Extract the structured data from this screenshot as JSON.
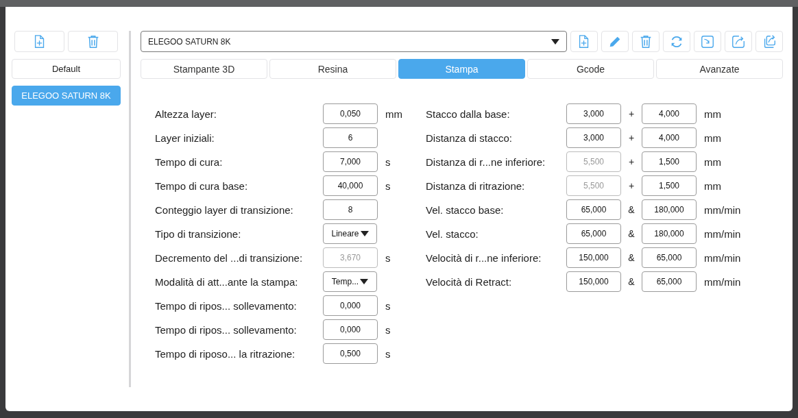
{
  "sidebar": {
    "items": [
      {
        "label": "Default",
        "selected": false
      },
      {
        "label": "ELEGOO SATURN 8K",
        "selected": true
      }
    ]
  },
  "printer_select": {
    "value": "ELEGOO SATURN 8K"
  },
  "tabs": [
    {
      "label": "Stampante 3D",
      "selected": false
    },
    {
      "label": "Resina",
      "selected": false
    },
    {
      "label": "Stampa",
      "selected": true
    },
    {
      "label": "Gcode",
      "selected": false
    },
    {
      "label": "Avanzate",
      "selected": false
    }
  ],
  "left_settings": [
    {
      "label": "Altezza layer:",
      "kind": "input",
      "value": "0,050",
      "disabled": false,
      "unit": "mm"
    },
    {
      "label": "Layer iniziali:",
      "kind": "input",
      "value": "6",
      "disabled": false
    },
    {
      "label": "Tempo di cura:",
      "kind": "input",
      "value": "7,000",
      "disabled": false,
      "unit": "s"
    },
    {
      "label": "Tempo di cura base:",
      "kind": "input",
      "value": "40,000",
      "disabled": false,
      "unit": "s"
    },
    {
      "label": "Conteggio layer di transizione:",
      "kind": "input",
      "value": "8",
      "disabled": false
    },
    {
      "label": "Tipo di transizione:",
      "kind": "dropdown",
      "value": "Lineare",
      "disabled": false
    },
    {
      "label": "Decremento del ...di transizione:",
      "kind": "input",
      "value": "3,670",
      "disabled": true,
      "unit": "s"
    },
    {
      "label": "Modalità di att...ante la stampa:",
      "kind": "dropdown",
      "value": "Temp...",
      "disabled": false
    },
    {
      "label": "Tempo di ripos... sollevamento:",
      "kind": "input",
      "value": "0,000",
      "disabled": false,
      "unit": "s"
    },
    {
      "label": "Tempo di ripos... sollevamento:",
      "kind": "input",
      "value": "0,000",
      "disabled": false,
      "unit": "s"
    },
    {
      "label": "Tempo di riposo... la ritrazione:",
      "kind": "input",
      "value": "0,500",
      "disabled": false,
      "unit": "s"
    }
  ],
  "right_settings": [
    {
      "label": "Stacco dalla base:",
      "value_1": "3,000",
      "disabled_1": false,
      "separator": "+",
      "value_2": "4,000",
      "unit": "mm"
    },
    {
      "label": "Distanza di stacco:",
      "value_1": "3,000",
      "disabled_1": false,
      "separator": "+",
      "value_2": "4,000",
      "unit": "mm"
    },
    {
      "label": "Distanza di r...ne inferiore:",
      "value_1": "5,500",
      "disabled_1": true,
      "separator": "+",
      "value_2": "1,500",
      "unit": "mm"
    },
    {
      "label": "Distanza di ritrazione:",
      "value_1": "5,500",
      "disabled_1": true,
      "separator": "+",
      "value_2": "1,500",
      "unit": "mm"
    },
    {
      "label": "Vel. stacco base:",
      "value_1": "65,000",
      "disabled_1": false,
      "separator": "&",
      "value_2": "180,000",
      "unit": "mm/min"
    },
    {
      "label": "Vel. stacco:",
      "value_1": "65,000",
      "disabled_1": false,
      "separator": "&",
      "value_2": "180,000",
      "unit": "mm/min"
    },
    {
      "label": "Velocità di r...ne inferiore:",
      "value_1": "150,000",
      "disabled_1": false,
      "separator": "&",
      "value_2": "65,000",
      "unit": "mm/min"
    },
    {
      "label": "Velocità di Retract:",
      "value_1": "150,000",
      "disabled_1": false,
      "separator": "&",
      "value_2": "65,000",
      "unit": "mm/min"
    }
  ]
}
